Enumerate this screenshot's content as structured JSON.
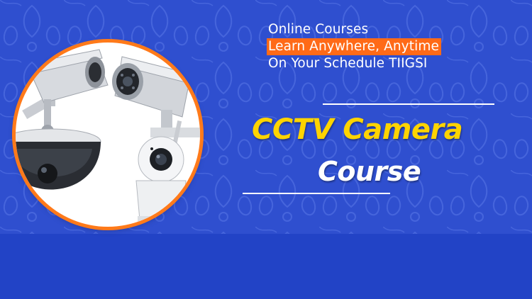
{
  "tagline": {
    "line1": "Online Courses",
    "line2": "Learn Anywhere, Anytime",
    "line3": "On Your Schedule TIIGSI"
  },
  "title": {
    "line1": "CCTV Camera",
    "line2": "Course"
  },
  "colors": {
    "background": "#2f4fcf",
    "bottom_band": "#2243c6",
    "highlight": "#ff6a17",
    "title_yellow": "#ffd400",
    "circle_border": "#ff7a1a"
  },
  "image": {
    "icons": [
      "bullet-camera-icon",
      "bullet-camera-icon",
      "dome-camera-icon",
      "wifi-camera-icon"
    ]
  }
}
